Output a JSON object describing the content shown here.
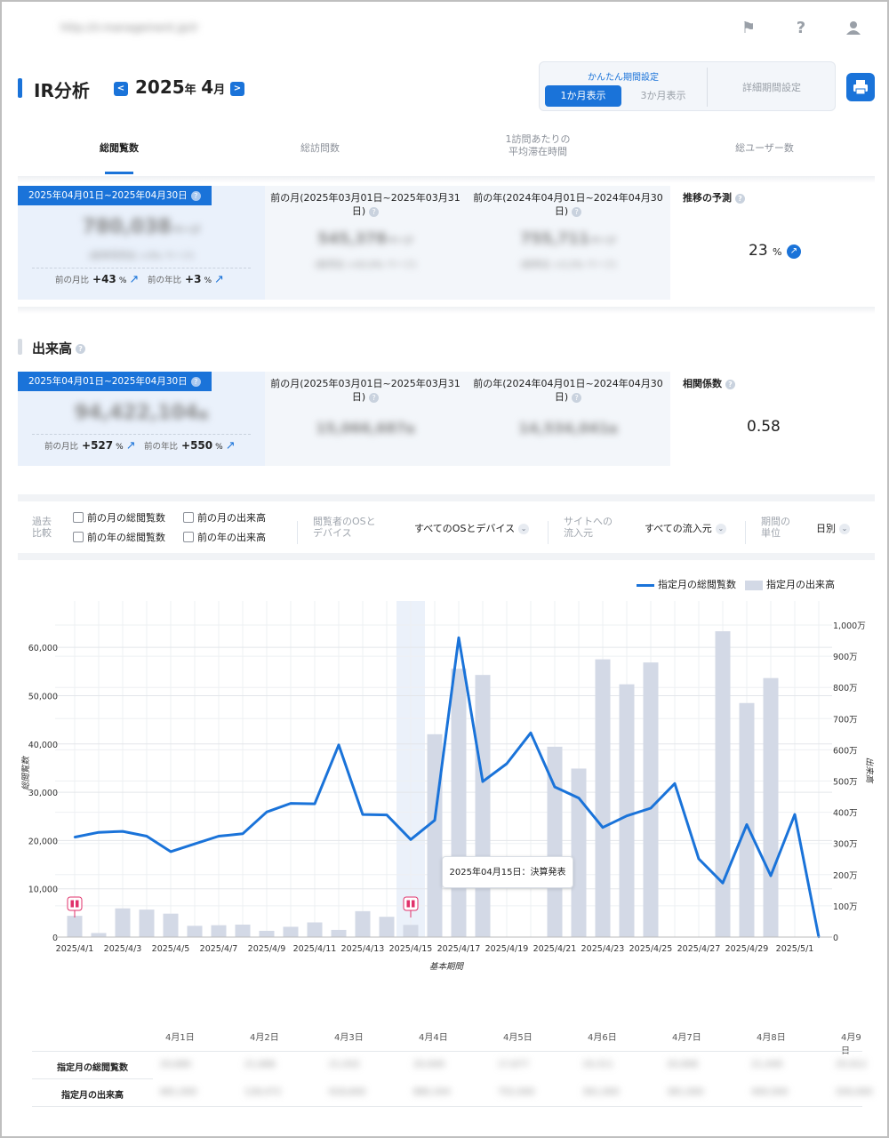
{
  "topbar": {
    "url": "http://ir.management.jp/ir"
  },
  "header": {
    "title": "IR分析",
    "year_label": "2025",
    "year_unit": "年",
    "month_label": "4",
    "month_unit": "月",
    "period_group_label": "かんたん期間設定",
    "btn_1m": "1か月表示",
    "btn_3m": "3か月表示",
    "btn_detail": "詳細期間設定"
  },
  "tabs": [
    {
      "label": "総閲覧数"
    },
    {
      "label": "総訪問数"
    },
    {
      "label_line1": "1訪問あたりの",
      "label_line2": "平均滞在時間"
    },
    {
      "label": "総ユーザー数"
    }
  ],
  "views_panel": {
    "current_range": "2025年04月01日~2025年04月30日",
    "current_value": "780,038",
    "current_unit": "ページ",
    "current_sub": "(前年同月比 +3% ページ)",
    "prev_month_label_1": "前の月(2025年03月01日~2025年03月31",
    "prev_month_label_2": "日)",
    "prev_month_value": "545,378",
    "prev_month_unit": "ページ",
    "prev_month_sub": "(前月比 +43.0% ページ)",
    "prev_year_label_1": "前の年(2024年04月01日~2024年04月30",
    "prev_year_label_2": "日)",
    "prev_year_value": "755,711",
    "prev_year_unit": "ページ",
    "prev_year_sub": "(前年比 +3.2% ページ)",
    "mom_label": "前の月比",
    "mom_value": "+43",
    "yoy_label": "前の年比",
    "yoy_value": "+3",
    "pct": "%",
    "prediction_label": "推移の予測",
    "prediction_value": "23",
    "prediction_unit": "%"
  },
  "volume_section": {
    "title": "出来高"
  },
  "volume_panel": {
    "current_range": "2025年04月01日~2025年04月30日",
    "current_value": "94,422,104",
    "current_unit": "株",
    "prev_month_label_1": "前の月(2025年03月01日~2025年03月31",
    "prev_month_label_2": "日)",
    "prev_month_value": "15,066,687",
    "prev_month_unit": "株",
    "prev_year_label_1": "前の年(2024年04月01日~2024年04月30",
    "prev_year_label_2": "日)",
    "prev_year_value": "14,534,041",
    "prev_year_unit": "株",
    "mom_label": "前の月比",
    "mom_value": "+527",
    "yoy_label": "前の年比",
    "yoy_value": "+550",
    "pct": "%",
    "correlation_label": "相関係数",
    "correlation_value": "0.58"
  },
  "filters": {
    "compare_label_1": "過去",
    "compare_label_2": "比較",
    "chk_prev_month_views": "前の月の総閲覧数",
    "chk_prev_year_views": "前の年の総閲覧数",
    "chk_prev_month_volume": "前の月の出来高",
    "chk_prev_year_volume": "前の年の出来高",
    "os_label_1": "閲覧者のOSと",
    "os_label_2": "デバイス",
    "os_value": "すべてのOSとデバイス",
    "source_label_1": "サイトへの",
    "source_label_2": "流入元",
    "source_value": "すべての流入元",
    "unit_label_1": "期間の",
    "unit_label_2": "単位",
    "unit_value": "日別"
  },
  "colors": {
    "accent": "#1a73d9",
    "bar": "#d3d9e6",
    "marker": "#e0326b"
  },
  "chart_data": {
    "type": "bar+line",
    "legend": [
      "指定月の総閲覧数",
      "指定月の出来高"
    ],
    "xlabel": "基本期間",
    "ylabel_left": "総閲覧数",
    "ylabel_right": "出来高",
    "ylim_left": [
      0,
      65000
    ],
    "ylim_right": [
      0,
      10000000
    ],
    "yticks_left": [
      "0",
      "10,000",
      "20,000",
      "30,000",
      "40,000",
      "50,000",
      "60,000"
    ],
    "yticks_right": [
      "0",
      "100万",
      "200万",
      "300万",
      "400万",
      "500万",
      "600万",
      "700万",
      "800万",
      "900万",
      "1,000万"
    ],
    "x_tick_labels": [
      "2025/4/1",
      "2025/4/3",
      "2025/4/5",
      "2025/4/7",
      "2025/4/9",
      "2025/4/11",
      "2025/4/13",
      "2025/4/15",
      "2025/4/17",
      "2025/4/19",
      "2025/4/21",
      "2025/4/23",
      "2025/4/25",
      "2025/4/27",
      "2025/4/29",
      "2025/5/1"
    ],
    "series": [
      {
        "name": "指定月の総閲覧数",
        "kind": "line",
        "values": [
          20700,
          21700,
          21900,
          20900,
          17700,
          19300,
          20900,
          21400,
          25900,
          27700,
          27600,
          39800,
          25400,
          25300,
          20200,
          24200,
          62000,
          32200,
          35900,
          42300,
          31100,
          28800,
          22700,
          25100,
          26700,
          31800,
          16200,
          11200,
          23300,
          12700,
          25400,
          0
        ]
      },
      {
        "name": "指定月の出来高",
        "kind": "bar",
        "values": [
          680000,
          130000,
          920000,
          880000,
          750000,
          360000,
          380000,
          400000,
          200000,
          330000,
          470000,
          230000,
          830000,
          650000,
          390000,
          6500000,
          8600000,
          8400000,
          0,
          0,
          6100000,
          5400000,
          8900000,
          8100000,
          8800000,
          0,
          0,
          9800000,
          7500000,
          8300000
        ]
      }
    ],
    "annotation": "2025年04月15日：決算発表"
  },
  "table": {
    "columns": [
      "4月1日",
      "4月2日",
      "4月3日",
      "4月4日",
      "4月5日",
      "4月6日",
      "4月7日",
      "4月8日",
      "4月9日"
    ],
    "row1_label": "指定月の総閲覧数",
    "row2_label": "指定月の出来高",
    "row1_values": [
      "20,680",
      "21,686",
      "21,932",
      "20,949",
      "17,677",
      "19,311",
      "20,908",
      "21,449",
      "25,912"
    ],
    "row2_values": [
      "681,000",
      "128,472",
      "918,600",
      "880,344",
      "752,000",
      "361,000",
      "381,000",
      "400,500",
      "200,000"
    ]
  }
}
